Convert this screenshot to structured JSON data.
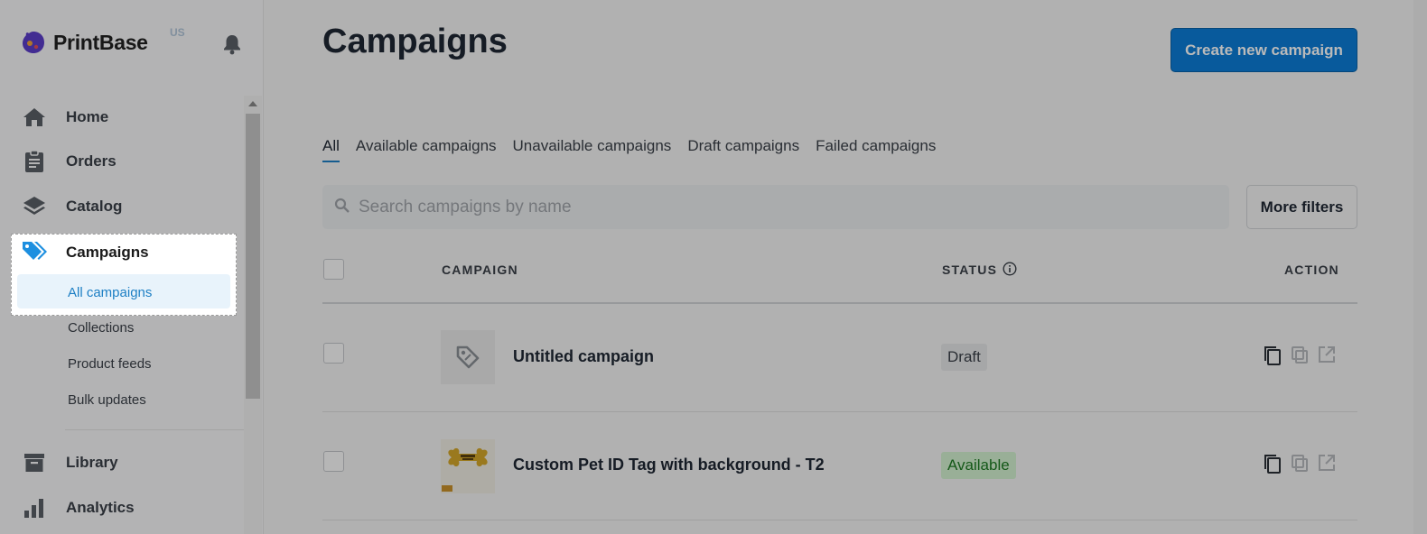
{
  "sidebar": {
    "logo_text": "PrintBase",
    "logo_sup": "US",
    "nav": [
      {
        "label": "Home",
        "icon": "home-icon"
      },
      {
        "label": "Orders",
        "icon": "clipboard-icon"
      },
      {
        "label": "Catalog",
        "icon": "layers-icon"
      },
      {
        "label": "Campaigns",
        "icon": "tag-icon"
      },
      {
        "label": "Library",
        "icon": "archive-icon"
      },
      {
        "label": "Analytics",
        "icon": "bar-chart-icon"
      }
    ],
    "campaign_sub": [
      {
        "label": "All campaigns"
      },
      {
        "label": "Collections"
      },
      {
        "label": "Product feeds"
      },
      {
        "label": "Bulk updates"
      }
    ]
  },
  "header": {
    "title": "Campaigns",
    "create_label": "Create new campaign"
  },
  "tabs": [
    {
      "label": "All"
    },
    {
      "label": "Available campaigns"
    },
    {
      "label": "Unavailable campaigns"
    },
    {
      "label": "Draft campaigns"
    },
    {
      "label": "Failed campaigns"
    }
  ],
  "search": {
    "placeholder": "Search campaigns by name",
    "more_filters_label": "More filters"
  },
  "table": {
    "headers": {
      "campaign": "CAMPAIGN",
      "status": "STATUS",
      "action": "ACTION"
    },
    "rows": [
      {
        "name": "Untitled campaign",
        "status": "Draft"
      },
      {
        "name": "Custom Pet ID Tag with background - T2",
        "status": "Available"
      }
    ]
  },
  "colors": {
    "accent": "#0b7cd6",
    "available": "#1e7a23"
  }
}
